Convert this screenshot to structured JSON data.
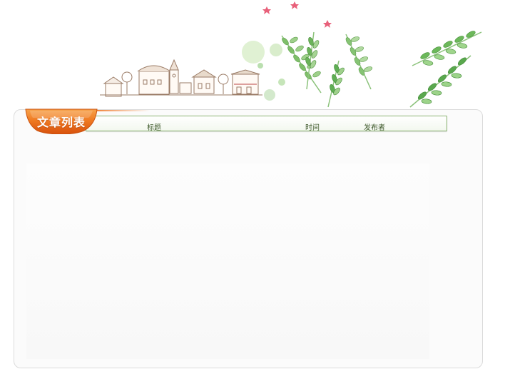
{
  "tab": {
    "label": "文章列表",
    "accent_color": "#ef6d16"
  },
  "table": {
    "columns": [
      "标题",
      "时间",
      "发布者"
    ],
    "header_border_color": "#8bb372"
  },
  "decorations": {
    "illustration": "town-houses-and-wheat-sprigs"
  }
}
